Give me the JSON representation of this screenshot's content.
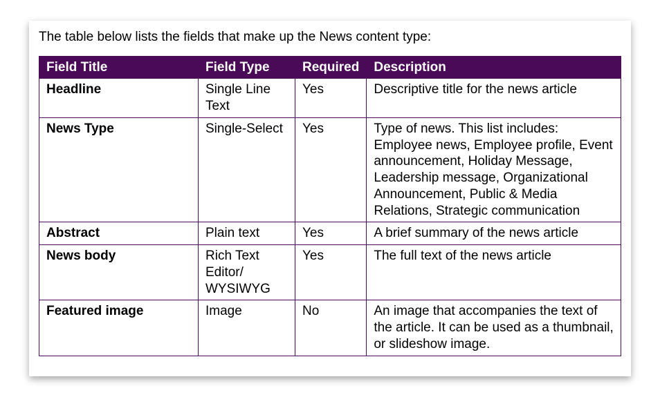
{
  "intro": "The table below lists the fields that make up the News content type:",
  "headers": {
    "title": "Field Title",
    "type": "Field Type",
    "required": "Required",
    "description": "Description"
  },
  "rows": [
    {
      "title": "Headline",
      "type": "Single Line Text",
      "required": "Yes",
      "description": "Descriptive title for the news article"
    },
    {
      "title": "News Type",
      "type": "Single-Select",
      "required": "Yes",
      "description": "Type of news. This list includes: Employee news, Employee profile, Event announcement, Holiday Message, Leadership message, Organizational Announcement, Public & Media Relations, Strategic communication"
    },
    {
      "title": "Abstract",
      "type": "Plain text",
      "required": "Yes",
      "description": "A brief summary of the news article"
    },
    {
      "title": "News body",
      "type": "Rich Text Editor/ WYSIWYG",
      "required": "Yes",
      "description": "The full text of the news article"
    },
    {
      "title": "Featured image",
      "type": "Image",
      "required": "No",
      "description": "An image that accompanies the text of the article. It can be used as a thumbnail, or slideshow image."
    }
  ]
}
